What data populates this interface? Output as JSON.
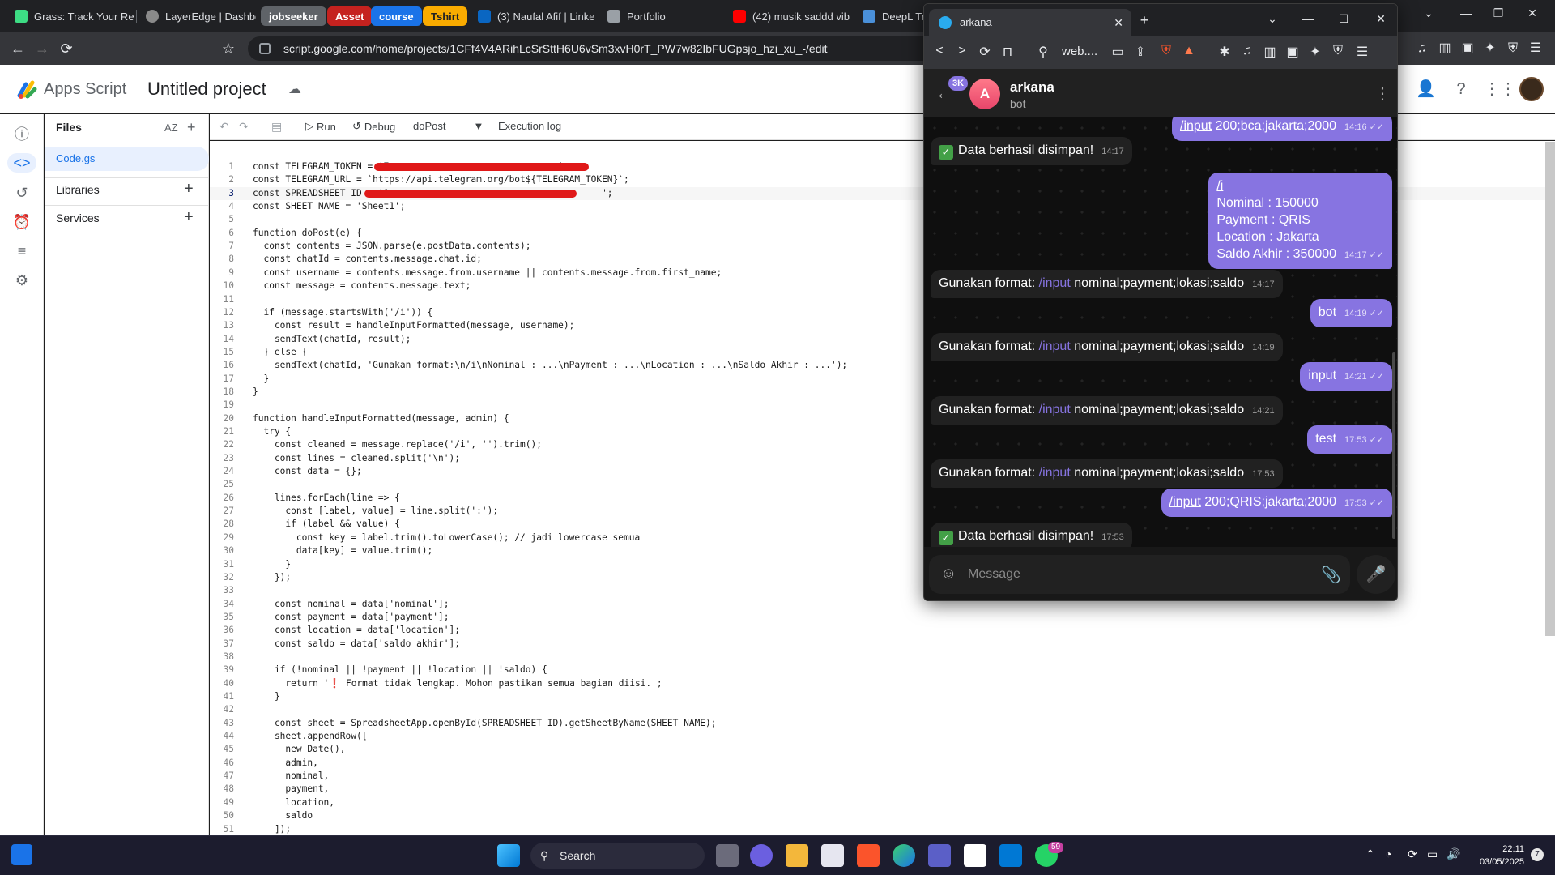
{
  "browser": {
    "tabs": [
      {
        "label": "Grass: Track Your Re",
        "color": "#3ddc84"
      },
      {
        "label": "LayerEdge | Dashboa",
        "color": "#8a8a8a"
      },
      {
        "label": "(3) Naufal Afif | Linke",
        "color": "#0a66c2"
      },
      {
        "label": "Portfolio",
        "color": "#9aa0a6"
      },
      {
        "label": "(42) musik saddd vib",
        "color": "#ff0000"
      },
      {
        "label": "DeepL Tra",
        "color": "#4a90d9"
      }
    ],
    "groups": [
      {
        "label": "jobseeker",
        "bg": "#5f6368",
        "fg": "#ffffff"
      },
      {
        "label": "Asset",
        "bg": "#c5221f",
        "fg": "#ffffff"
      },
      {
        "label": "course",
        "bg": "#1a73e8",
        "fg": "#ffffff"
      },
      {
        "label": "Tshirt",
        "bg": "#f9ab00",
        "fg": "#202124"
      }
    ],
    "url": "script.google.com/home/projects/1CFf4V4ARihLcSrSttH6U6vSm3xvH0rT_PW7w82IbFUGpsjo_hzi_xu_-/edit"
  },
  "apps_script": {
    "app_name": "Apps Script",
    "project_name": "Untitled project",
    "files_label": "Files",
    "file_name": "Code.gs",
    "libraries_label": "Libraries",
    "services_label": "Services",
    "run_label": "Run",
    "debug_label": "Debug",
    "function_select": "doPost",
    "execution_log_label": "Execution log",
    "current_line": 3
  },
  "code_lines": [
    "const TELEGRAM_TOKEN = '7                               ';",
    "const TELEGRAM_URL = `https://api.telegram.org/bot${TELEGRAM_TOKEN}`;",
    "const SPREADSHEET_ID = '1                                       ';",
    "const SHEET_NAME = 'Sheet1';",
    "",
    "function doPost(e) {",
    "  const contents = JSON.parse(e.postData.contents);",
    "  const chatId = contents.message.chat.id;",
    "  const username = contents.message.from.username || contents.message.from.first_name;",
    "  const message = contents.message.text;",
    "",
    "  if (message.startsWith('/i')) {",
    "    const result = handleInputFormatted(message, username);",
    "    sendText(chatId, result);",
    "  } else {",
    "    sendText(chatId, 'Gunakan format:\\n/i\\nNominal : ...\\nPayment : ...\\nLocation : ...\\nSaldo Akhir : ...');",
    "  }",
    "}",
    "",
    "function handleInputFormatted(message, admin) {",
    "  try {",
    "    const cleaned = message.replace('/i', '').trim();",
    "    const lines = cleaned.split('\\n');",
    "    const data = {};",
    "",
    "    lines.forEach(line => {",
    "      const [label, value] = line.split(':');",
    "      if (label && value) {",
    "        const key = label.trim().toLowerCase(); // jadi lowercase semua",
    "        data[key] = value.trim();",
    "      }",
    "    });",
    "",
    "    const nominal = data['nominal'];",
    "    const payment = data['payment'];",
    "    const location = data['location'];",
    "    const saldo = data['saldo akhir'];",
    "",
    "    if (!nominal || !payment || !location || !saldo) {",
    "      return '❗ Format tidak lengkap. Mohon pastikan semua bagian diisi.';",
    "    }",
    "",
    "    const sheet = SpreadsheetApp.openById(SPREADSHEET_ID).getSheetByName(SHEET_NAME);",
    "    sheet.appendRow([",
    "      new Date(),",
    "      admin,",
    "      nominal,",
    "      payment,",
    "      location,",
    "      saldo",
    "    ]);"
  ],
  "telegram": {
    "tab_title": "arkana",
    "url_short": "web....",
    "chat_name": "arkana",
    "chat_status": "bot",
    "unread_badge": "3K",
    "avatar_letter": "A",
    "composer_placeholder": "Message",
    "messages": [
      {
        "dir": "out",
        "cmd": "/input",
        "text": " 200;bca;jakarta;2000",
        "time": "14:16"
      },
      {
        "dir": "in",
        "check": true,
        "text": "Data berhasil disimpan!",
        "time": "14:17"
      },
      {
        "dir": "out",
        "cmd": "/i",
        "text": "\nNominal : 150000\nPayment : QRIS\nLocation : Jakarta\nSaldo Akhir : 350000",
        "time": "14:17"
      },
      {
        "dir": "in",
        "prefix": "Gunakan format: ",
        "cmd": "/input",
        "text": " nominal;payment;lokasi;saldo",
        "time": "14:17"
      },
      {
        "dir": "out",
        "text": "bot",
        "time": "14:19"
      },
      {
        "dir": "in",
        "prefix": "Gunakan format: ",
        "cmd": "/input",
        "text": " nominal;payment;lokasi;saldo",
        "time": "14:19"
      },
      {
        "dir": "out",
        "text": "input",
        "time": "14:21"
      },
      {
        "dir": "in",
        "prefix": "Gunakan format: ",
        "cmd": "/input",
        "text": " nominal;payment;lokasi;saldo",
        "time": "14:21"
      },
      {
        "dir": "out",
        "text": "test",
        "time": "17:53"
      },
      {
        "dir": "in",
        "prefix": "Gunakan format: ",
        "cmd": "/input",
        "text": " nominal;payment;lokasi;saldo",
        "time": "17:53"
      },
      {
        "dir": "out",
        "cmd": "/input",
        "text": " 200;QRIS;jakarta;2000",
        "time": "17:53"
      },
      {
        "dir": "in",
        "check": true,
        "text": "Data berhasil disimpan!",
        "time": "17:53"
      }
    ]
  },
  "taskbar": {
    "search_placeholder": "Search",
    "time": "22:11",
    "date": "03/05/2025",
    "whatsapp_badge": "59",
    "notification_count": "7"
  }
}
